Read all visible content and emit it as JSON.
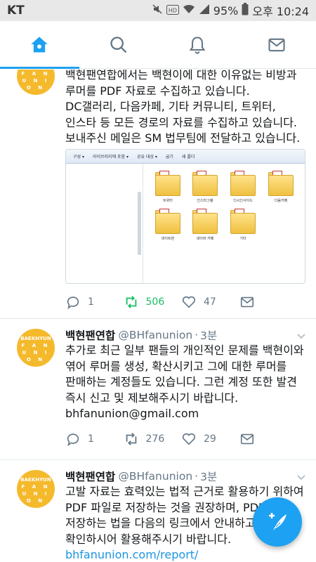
{
  "status_bar": {
    "carrier": "KT",
    "battery": "95%",
    "time": "오후 10:24",
    "icons": [
      "mute-icon",
      "hd-icon",
      "wifi-icon",
      "signal-icon",
      "battery-icon"
    ]
  },
  "tabs": [
    {
      "name": "home",
      "icon": "home-icon",
      "active": true
    },
    {
      "name": "search",
      "icon": "search-icon",
      "active": false
    },
    {
      "name": "notifications",
      "icon": "bell-icon",
      "active": false
    },
    {
      "name": "messages",
      "icon": "mail-icon",
      "active": false
    }
  ],
  "avatar": {
    "lines": [
      "BAEKHYUN",
      "F A N",
      "U N I O N"
    ],
    "partial_lines": [
      "F A N",
      "U N I O N"
    ],
    "color": "#f5b92c"
  },
  "tweets": [
    {
      "body_lines": [
        "백현팬연합에서는 백현이에 대한 이유없는 비방과",
        "루머를 PDF 자료로 수집하고 있습니다.",
        "DC갤러리, 다음카페, 기타 커뮤니티, 트위터,",
        "인스타 등 모든 경로의 자료를 수집하고 있습니다.",
        "보내주신 메일은 SM 법무팀에 전달하고 있습니다."
      ],
      "media": {
        "toolbar": [
          "구성 ▾",
          "라이브러리에 포함 ▾",
          "공유 대상 ▾",
          "굽기",
          "새 폴더"
        ],
        "folders": [
          "트위터",
          "인스타그램",
          "디시인사이드",
          "다음카페",
          "네이트판",
          "네이버 카페",
          "기타"
        ]
      },
      "replies": "1",
      "retweets": "506",
      "likes": "47"
    },
    {
      "name": "백현팬연합",
      "handle": "@BHfanunion",
      "time": "3분",
      "body_lines": [
        "추가로 최근 일부 팬들의 개인적인 문제를 백현이와",
        "엮어 루머를 생성, 확산시키고 그에 대한 루머를",
        "판매하는 계정들도 있습니다. 그런 계정 또한 발견",
        "즉시 신고 및 제보해주시기 바랍니다.",
        "bhfanunion@gmail.com"
      ],
      "replies": "1",
      "retweets": "276",
      "likes": "29"
    },
    {
      "name": "백현팬연합",
      "handle": "@BHfanunion",
      "time": "3분",
      "body_lines": [
        "고발 자료는 효력있는 법적 근거로 활용하기 위하여",
        "PDF 파일로 저장하는 것을 권장하며, PDF",
        "저장하는 법을 다음의 링크에서 안내하고",
        "확인하시어 활용해주시기 바랍니다.",
        "bhfanunion.com/report/"
      ]
    }
  ],
  "colors": {
    "accent": "#1da1f2",
    "retweet": "#17bf63",
    "link": "#1b95e0",
    "muted": "#657786"
  }
}
